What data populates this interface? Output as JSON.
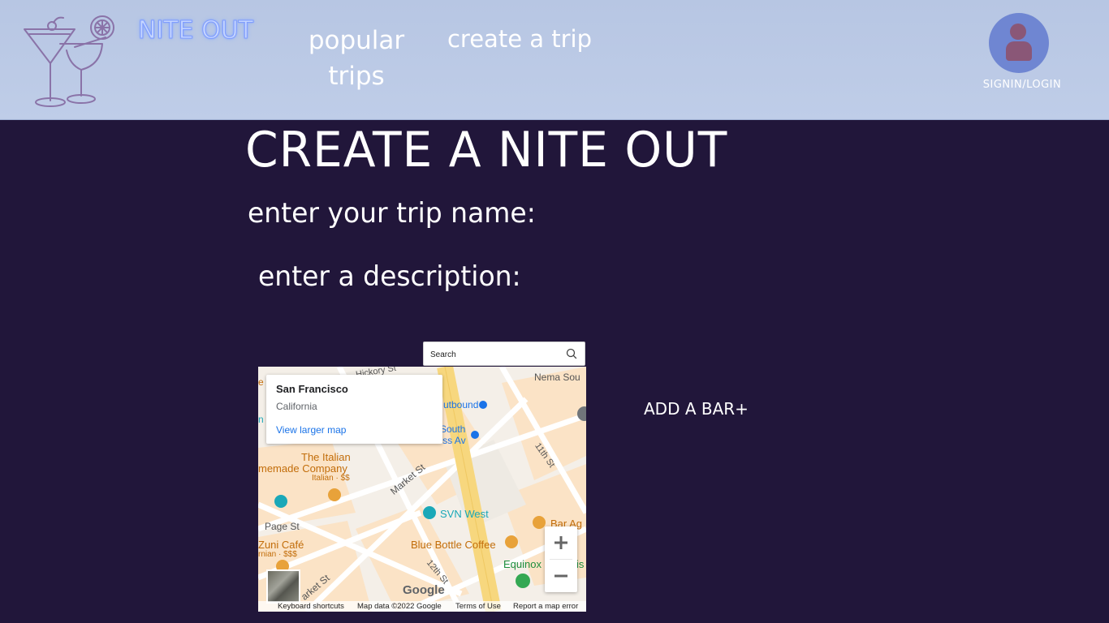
{
  "header": {
    "brand": "NITE OUT",
    "nav": {
      "popular_line1": "popular",
      "popular_line2": "trips",
      "create": "create a trip"
    },
    "signin": "SIGNIN/LOGIN"
  },
  "main": {
    "title": "CREATE A NITE OUT",
    "trip_name_label": "enter your trip name:",
    "description_label": "enter a description:",
    "add_bar": "ADD A BAR+"
  },
  "search": {
    "placeholder": "Search"
  },
  "map": {
    "place_title": "San Francisco",
    "place_subtitle": "California",
    "view_larger": "View larger map",
    "labels": {
      "hickory": "Hickory St",
      "nema": "Nema Sou",
      "outbound": "utbound",
      "south": "South",
      "van_ness": "Van Ness Av",
      "eleventh": "11th St",
      "italian_home_1": "The Italian",
      "italian_home_2": "memade Company",
      "italian_sub": "Italian · $$",
      "market_st": "Market St",
      "svn_west": "SVN West",
      "bar_ag": "Bar Ag",
      "page_st": "Page St",
      "zuni_1": "Zuni Café",
      "zuni_2": "rnian · $$$",
      "blue_bottle": "Blue Bottle Coffee",
      "equinox": "Equinox",
      "twelfth": "12th St",
      "market_st_2": "arket St",
      "edge_is": "is",
      "edge_e": "e",
      "edge_n": "n"
    },
    "google": "Google",
    "footer": {
      "shortcuts": "Keyboard shortcuts",
      "data": "Map data ©2022 Google",
      "terms": "Terms of Use",
      "report": "Report a map error"
    }
  },
  "colors": {
    "header_bg": "#bfcde8",
    "page_bg": "#21163a",
    "avatar": "#6f86d2",
    "avatar_figure": "#8a5777",
    "map_road_major": "#f7d77e",
    "map_link": "#1a73e8"
  },
  "icons": [
    "cocktail-logo-icon",
    "user-avatar-icon",
    "search-icon",
    "zoom-in-icon",
    "zoom-out-icon"
  ]
}
